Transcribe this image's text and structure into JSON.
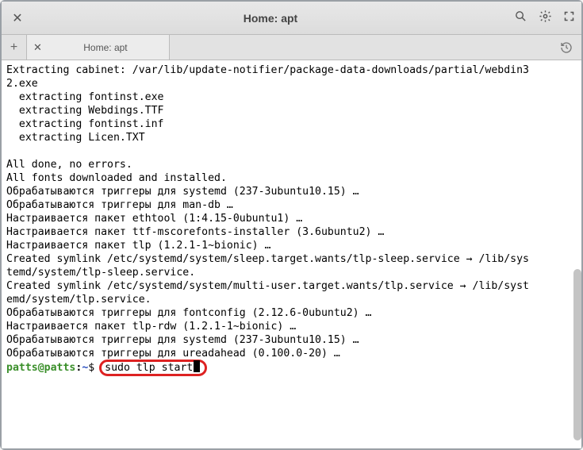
{
  "window": {
    "title": "Home: apt"
  },
  "tab": {
    "label": "Home: apt"
  },
  "terminal": {
    "lines": [
      "Extracting cabinet: /var/lib/update-notifier/package-data-downloads/partial/webdin3",
      "2.exe",
      "  extracting fontinst.exe",
      "  extracting Webdings.TTF",
      "  extracting fontinst.inf",
      "  extracting Licen.TXT",
      "",
      "All done, no errors.",
      "All fonts downloaded and installed.",
      "Обрабатываются триггеры для systemd (237-3ubuntu10.15) …",
      "Обрабатываются триггеры для man-db …",
      "Настраивается пакет ethtool (1:4.15-0ubuntu1) …",
      "Настраивается пакет ttf-mscorefonts-installer (3.6ubuntu2) …",
      "Настраивается пакет tlp (1.2.1-1~bionic) …",
      "Created symlink /etc/systemd/system/sleep.target.wants/tlp-sleep.service → /lib/sys",
      "temd/system/tlp-sleep.service.",
      "Created symlink /etc/systemd/system/multi-user.target.wants/tlp.service → /lib/syst",
      "emd/system/tlp.service.",
      "Обрабатываются триггеры для fontconfig (2.12.6-0ubuntu2) …",
      "Настраивается пакет tlp-rdw (1.2.1-1~bionic) …",
      "Обрабатываются триггеры для systemd (237-3ubuntu10.15) …",
      "Обрабатываются триггеры для ureadahead (0.100.0-20) …"
    ],
    "prompt": {
      "user": "patts",
      "host": "patts",
      "path": "~",
      "symbol": "$"
    },
    "command": "sudo tlp start"
  },
  "scroll": {
    "thumb_top_pct": 54,
    "thumb_height_pct": 44
  }
}
